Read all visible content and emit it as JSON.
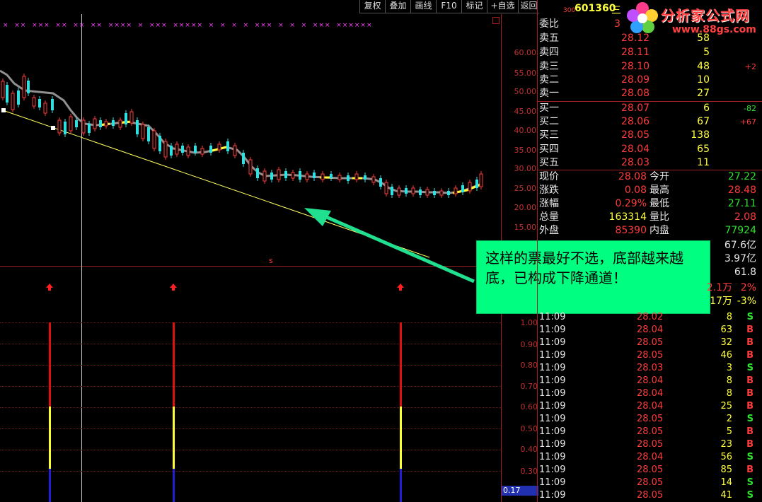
{
  "toolbar": {
    "items": [
      "复权",
      "叠加",
      "画线",
      "F10",
      "标记",
      "+自选",
      "返回"
    ]
  },
  "header": {
    "market_code": "300",
    "stock_code": "601360",
    "stock_name_char": "三"
  },
  "logo": {
    "title": "分析家公式网",
    "url": "www.88gs.com"
  },
  "main_chart": {
    "y_ticks": [
      "60.00",
      "55.00",
      "50.00",
      "45.00",
      "40.00",
      "35.00",
      "30.00",
      "25.00",
      "20.00",
      "15.00"
    ],
    "marker_s": "s",
    "top_markers": "×  ××  ×××  ××  ××  ××  ××××  ×  ×××  ×××××  ×  ×  ×  ×  ×××  ×  ×  ×  ×××  ××××××"
  },
  "indicator": {
    "y_ticks": [
      "1.00",
      "0.90",
      "0.80",
      "0.70",
      "0.60",
      "0.50",
      "0.40",
      "0.30"
    ],
    "current": "0.17"
  },
  "quote": {
    "weibi": {
      "label": "委比",
      "value": "3"
    },
    "sell": [
      {
        "label": "卖五",
        "price": "28.12",
        "vol": "58",
        "chg": ""
      },
      {
        "label": "卖四",
        "price": "28.11",
        "vol": "5",
        "chg": ""
      },
      {
        "label": "卖三",
        "price": "28.10",
        "vol": "48",
        "chg": "+2"
      },
      {
        "label": "卖二",
        "price": "28.09",
        "vol": "10",
        "chg": ""
      },
      {
        "label": "卖一",
        "price": "28.08",
        "vol": "27",
        "chg": ""
      }
    ],
    "buy": [
      {
        "label": "买一",
        "price": "28.07",
        "vol": "6",
        "chg": "-82"
      },
      {
        "label": "买二",
        "price": "28.06",
        "vol": "67",
        "chg": "+67"
      },
      {
        "label": "买三",
        "price": "28.05",
        "vol": "138",
        "chg": ""
      },
      {
        "label": "买四",
        "price": "28.04",
        "vol": "65",
        "chg": ""
      },
      {
        "label": "买五",
        "price": "28.03",
        "vol": "11",
        "chg": ""
      }
    ],
    "stats": [
      {
        "l1": "现价",
        "v1": "28.08",
        "l2": "今开",
        "v2": "27.22"
      },
      {
        "l1": "涨跌",
        "v1": "0.08",
        "l2": "最高",
        "v2": "28.48"
      },
      {
        "l1": "涨幅",
        "v1": "0.29%",
        "l2": "最低",
        "v2": "27.11"
      },
      {
        "l1": "总量",
        "v1": "163314",
        "l2": "量比",
        "v2": "2.08"
      },
      {
        "l1": "外盘",
        "v1": "85390",
        "l2": "内盘",
        "v2": "77924"
      }
    ],
    "extra": [
      "67.6亿",
      "3.97亿",
      "61.8"
    ],
    "extra2": [
      {
        "a": "2.1万",
        "b": "2%"
      },
      {
        "a": "17万",
        "b": "-3%"
      }
    ]
  },
  "ticks": [
    {
      "t": "11:09",
      "p": "28.02",
      "v": "8",
      "s": "S"
    },
    {
      "t": "11:09",
      "p": "28.04",
      "v": "63",
      "s": "B"
    },
    {
      "t": "11:09",
      "p": "28.05",
      "v": "32",
      "s": "B"
    },
    {
      "t": "11:09",
      "p": "28.05",
      "v": "46",
      "s": "B"
    },
    {
      "t": "11:09",
      "p": "28.03",
      "v": "3",
      "s": "S"
    },
    {
      "t": "11:09",
      "p": "28.04",
      "v": "8",
      "s": "B"
    },
    {
      "t": "11:09",
      "p": "28.04",
      "v": "8",
      "s": "B"
    },
    {
      "t": "11:09",
      "p": "28.04",
      "v": "25",
      "s": "B"
    },
    {
      "t": "11:09",
      "p": "28.05",
      "v": "2",
      "s": "S"
    },
    {
      "t": "11:09",
      "p": "28.05",
      "v": "5",
      "s": "B"
    },
    {
      "t": "11:09",
      "p": "28.05",
      "v": "23",
      "s": "B"
    },
    {
      "t": "11:09",
      "p": "28.04",
      "v": "56",
      "s": "S"
    },
    {
      "t": "11:09",
      "p": "28.05",
      "v": "85",
      "s": "B"
    },
    {
      "t": "11:09",
      "p": "28.05",
      "v": "14",
      "s": "S"
    },
    {
      "t": "11:09",
      "p": "28.05",
      "v": "41",
      "s": "S"
    }
  ],
  "callout": {
    "text": "这样的票最好不选，底部越来越底，已构成下降通道！"
  },
  "colors": {
    "up": "#ff3c3c",
    "down": "#30e0e0",
    "ma": "#909090",
    "trend": "#ffff60",
    "arrow": "#20e090",
    "callout_bg": "#00ff80"
  }
}
